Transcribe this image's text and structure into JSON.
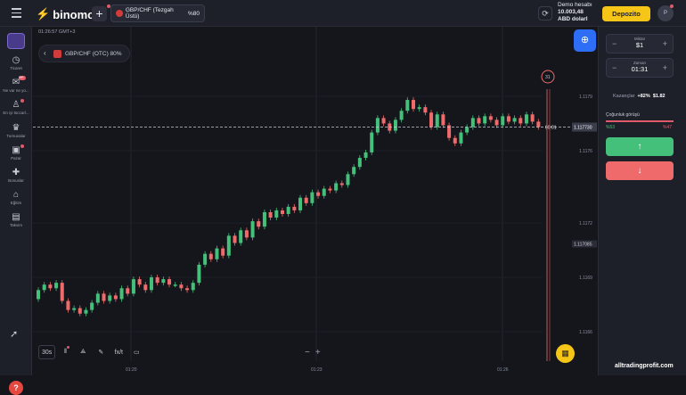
{
  "topbar": {
    "logo": "binomo",
    "asset_tab": "GBP/CHF (Tezgah Üstü)",
    "asset_tab_pct": "%80",
    "account_label": "Demo hesabı",
    "balance": "10.003,48",
    "currency": "ABD dolarl",
    "deposit": "Depozito",
    "avatar": "P"
  },
  "sidebar": {
    "items": [
      {
        "label": "Ticaret",
        "icon": "clock-icon"
      },
      {
        "label": "Ne var ne yo...",
        "icon": "megaphone-icon",
        "badge": "99+"
      },
      {
        "label": "En iyi tüccarl...",
        "icon": "trophy-person-icon"
      },
      {
        "label": "Turnuvalar",
        "icon": "cup-icon"
      },
      {
        "label": "Pazar",
        "icon": "bag-icon"
      },
      {
        "label": "Bonuslar",
        "icon": "gift-icon"
      },
      {
        "label": "Eğitim",
        "icon": "graduation-icon"
      },
      {
        "label": "Takvim",
        "icon": "calendar-icon"
      }
    ]
  },
  "chart": {
    "time": "01:26:57 GMT+3",
    "asset_label": "GBP/CHF (OTC) 80%",
    "current_price": "1.117730",
    "time_marker": "00:01",
    "countdown": "31",
    "mid_price_label": "1.117085",
    "toolbar": {
      "timeframe": "30s",
      "indicator": "fx/t"
    }
  },
  "chart_data": {
    "type": "candlestick",
    "ytick_labels": [
      "1.1179",
      "1.1176",
      "1.1172",
      "1.1169",
      "1.1166"
    ],
    "xtick_labels": [
      "01:20",
      "01:23",
      "01:26"
    ],
    "candles": [
      [
        1.11678,
        1.11683
      ],
      [
        1.11683,
        1.11686
      ],
      [
        1.11686,
        1.11684
      ],
      [
        1.11684,
        1.11687
      ],
      [
        1.11687,
        1.11677
      ],
      [
        1.11677,
        1.11672
      ],
      [
        1.11672,
        1.11673
      ],
      [
        1.11673,
        1.1167
      ],
      [
        1.1167,
        1.11672
      ],
      [
        1.11672,
        1.11676
      ],
      [
        1.11676,
        1.11681
      ],
      [
        1.11681,
        1.11677
      ],
      [
        1.11677,
        1.1168
      ],
      [
        1.1168,
        1.11678
      ],
      [
        1.11678,
        1.11684
      ],
      [
        1.11684,
        1.11681
      ],
      [
        1.11681,
        1.11689
      ],
      [
        1.11689,
        1.11686
      ],
      [
        1.11686,
        1.11683
      ],
      [
        1.11683,
        1.1169
      ],
      [
        1.1169,
        1.11687
      ],
      [
        1.11687,
        1.11689
      ],
      [
        1.11689,
        1.11686
      ],
      [
        1.11686,
        1.11686
      ],
      [
        1.11686,
        1.11684
      ],
      [
        1.11684,
        1.11683
      ],
      [
        1.11683,
        1.11687
      ],
      [
        1.11687,
        1.11697
      ],
      [
        1.11697,
        1.11703
      ],
      [
        1.11703,
        1.117
      ],
      [
        1.117,
        1.11706
      ],
      [
        1.11706,
        1.11702
      ],
      [
        1.11702,
        1.11713
      ],
      [
        1.11713,
        1.11709
      ],
      [
        1.11709,
        1.11716
      ],
      [
        1.11716,
        1.11712
      ],
      [
        1.11712,
        1.11721
      ],
      [
        1.11721,
        1.11718
      ],
      [
        1.11718,
        1.11726
      ],
      [
        1.11726,
        1.11723
      ],
      [
        1.11723,
        1.11727
      ],
      [
        1.11727,
        1.11725
      ],
      [
        1.11725,
        1.11729
      ],
      [
        1.11729,
        1.11727
      ],
      [
        1.11727,
        1.11734
      ],
      [
        1.11734,
        1.11731
      ],
      [
        1.11731,
        1.11737
      ],
      [
        1.11737,
        1.11735
      ],
      [
        1.11735,
        1.11739
      ],
      [
        1.11739,
        1.11738
      ],
      [
        1.11738,
        1.11742
      ],
      [
        1.11742,
        1.11741
      ],
      [
        1.11741,
        1.11747
      ],
      [
        1.11747,
        1.11751
      ],
      [
        1.11751,
        1.11756
      ],
      [
        1.11756,
        1.11759
      ],
      [
        1.11759,
        1.1177
      ],
      [
        1.1177,
        1.11778
      ],
      [
        1.11778,
        1.11775
      ],
      [
        1.11775,
        1.11771
      ],
      [
        1.11771,
        1.11777
      ],
      [
        1.11777,
        1.11782
      ],
      [
        1.11782,
        1.11788
      ],
      [
        1.11788,
        1.11783
      ],
      [
        1.11783,
        1.11784
      ],
      [
        1.11784,
        1.11781
      ],
      [
        1.11781,
        1.11773
      ],
      [
        1.11773,
        1.1178
      ],
      [
        1.1178,
        1.11774
      ],
      [
        1.11774,
        1.11767
      ],
      [
        1.11767,
        1.11764
      ],
      [
        1.11764,
        1.1177
      ],
      [
        1.1177,
        1.11773
      ],
      [
        1.11773,
        1.11778
      ],
      [
        1.11778,
        1.11775
      ],
      [
        1.11775,
        1.11779
      ],
      [
        1.11779,
        1.11777
      ],
      [
        1.11777,
        1.11774
      ],
      [
        1.11774,
        1.11779
      ],
      [
        1.11779,
        1.11776
      ],
      [
        1.11776,
        1.11778
      ],
      [
        1.11778,
        1.11775
      ],
      [
        1.11775,
        1.1178
      ],
      [
        1.1178,
        1.11776
      ],
      [
        1.11776,
        1.11773
      ]
    ]
  },
  "panel": {
    "amount_label": "Miktar",
    "amount": "$1",
    "time_label": "Zaman",
    "time": "01:31",
    "earnings_label": "Kazançlar",
    "earnings_pct": "+82%",
    "earnings_value": "$1.82",
    "sentiment_label": "Çoğunluk görüşü",
    "sentiment_up": "%53",
    "sentiment_down": "%47",
    "sentiment_up_value": 0.53
  },
  "watermark": "alltradingprofit.com",
  "colors": {
    "up": "#44c07a",
    "down": "#ef6b6b",
    "accent": "#f5c518",
    "social": "#2e6df6"
  }
}
